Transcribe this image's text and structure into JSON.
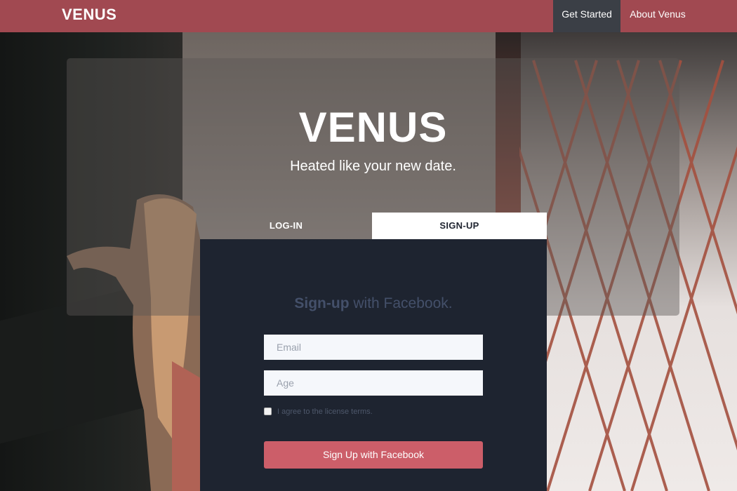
{
  "navbar": {
    "brand": "VENUS",
    "links": [
      "Get Started",
      "About Venus"
    ]
  },
  "hero": {
    "title": "VENUS",
    "subtitle": "Heated like your new date."
  },
  "tabs": [
    "LOG-IN",
    "SIGN-UP"
  ],
  "form": {
    "title_strong": "Sign-up",
    "title_rest": "with Facebook.",
    "email_placeholder": "Email",
    "age_placeholder": "Age",
    "agree_label": "I agree to the license terms.",
    "submit_label": "Sign Up with Facebook"
  },
  "colors": {
    "navbar": "#a64a52",
    "active_nav": "#3b3f46",
    "form_panel": "#1e2430",
    "button": "#cc5e69"
  }
}
